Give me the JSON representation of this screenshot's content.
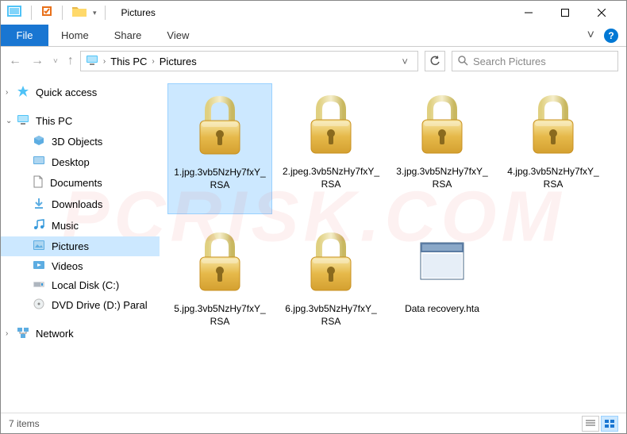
{
  "title": "Pictures",
  "ribbon": {
    "file": "File",
    "tabs": [
      "Home",
      "Share",
      "View"
    ]
  },
  "breadcrumb": {
    "items": [
      "This PC",
      "Pictures"
    ]
  },
  "search": {
    "placeholder": "Search Pictures"
  },
  "sidebar": {
    "quick": "Quick access",
    "thispc": "This PC",
    "items": [
      "3D Objects",
      "Desktop",
      "Documents",
      "Downloads",
      "Music",
      "Pictures",
      "Videos",
      "Local Disk (C:)",
      "DVD Drive (D:) Paral"
    ],
    "network": "Network"
  },
  "files": [
    {
      "name": "1.jpg.3vb5NzHy7fxY_RSA",
      "type": "lock"
    },
    {
      "name": "2.jpeg.3vb5NzHy7fxY_RSA",
      "type": "lock"
    },
    {
      "name": "3.jpg.3vb5NzHy7fxY_RSA",
      "type": "lock"
    },
    {
      "name": "4.jpg.3vb5NzHy7fxY_RSA",
      "type": "lock"
    },
    {
      "name": "5.jpg.3vb5NzHy7fxY_RSA",
      "type": "lock"
    },
    {
      "name": "6.jpg.3vb5NzHy7fxY_RSA",
      "type": "lock"
    },
    {
      "name": "Data recovery.hta",
      "type": "hta"
    }
  ],
  "status": "7 items"
}
